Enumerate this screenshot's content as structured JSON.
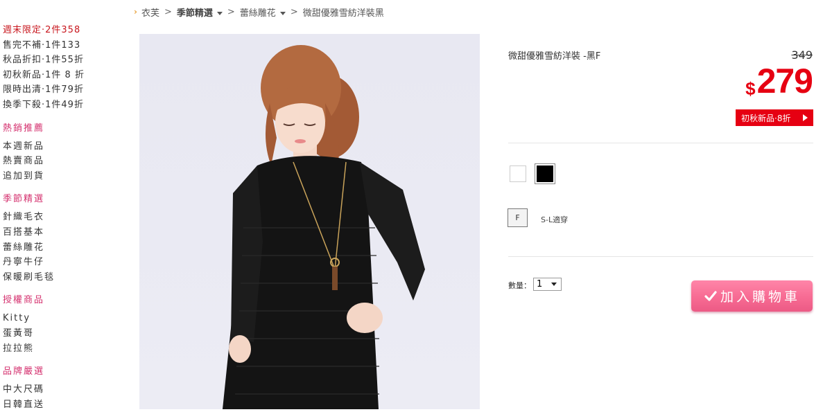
{
  "breadcrumb": {
    "items": [
      {
        "label": "衣芙",
        "bold": false,
        "dropdown": false
      },
      {
        "label": "季節精選",
        "bold": true,
        "dropdown": true
      },
      {
        "label": "蕾絲雕花",
        "bold": false,
        "dropdown": true
      },
      {
        "label": "微甜優雅雪紡洋裝黑",
        "bold": false,
        "dropdown": false
      }
    ],
    "separator": ">"
  },
  "sidebar": {
    "promos": [
      {
        "label": "週末限定·2件358",
        "highlight": true
      },
      {
        "label": "售完不補·1件133",
        "highlight": false
      },
      {
        "label": "秋品折扣·1件55折",
        "highlight": false
      },
      {
        "label": "初秋新品·1件 8 折",
        "highlight": false
      },
      {
        "label": "限時出清·1件79折",
        "highlight": false
      },
      {
        "label": "換季下殺·1件49折",
        "highlight": false
      }
    ],
    "sections": [
      {
        "title": "熱銷推薦",
        "links": [
          "本週新品",
          "熱賣商品",
          "追加到貨"
        ]
      },
      {
        "title": "季節精選",
        "links": [
          "針織毛衣",
          "百搭基本",
          "蕾絲雕花",
          "丹寧牛仔",
          "保暖刷毛毯"
        ]
      },
      {
        "title": "授權商品",
        "links": [
          "Kitty",
          "蛋黃哥",
          "拉拉熊"
        ]
      },
      {
        "title": "品牌嚴選",
        "links": [
          "中大尺碼",
          "日韓直送"
        ]
      }
    ]
  },
  "product": {
    "title": "微甜優雅雪紡洋裝 -黑F",
    "original_price": "349",
    "currency_symbol": "$",
    "sale_price": "279",
    "promo_badge": "初秋新品·8折",
    "colors": [
      {
        "name": "white",
        "hex": "#ffffff",
        "selected": false
      },
      {
        "name": "black",
        "hex": "#000000",
        "selected": true
      }
    ],
    "size": "F",
    "size_note": "S-L適穿",
    "quantity_label": "數量：",
    "quantity_value": "1",
    "add_to_cart_label": "加入購物車"
  },
  "theme": {
    "accent_red": "#e60012",
    "sidebar_section_color": "#d4306e",
    "cart_button_pink": "#f76b93",
    "breadcrumb_arrow": "#e8a33c"
  }
}
